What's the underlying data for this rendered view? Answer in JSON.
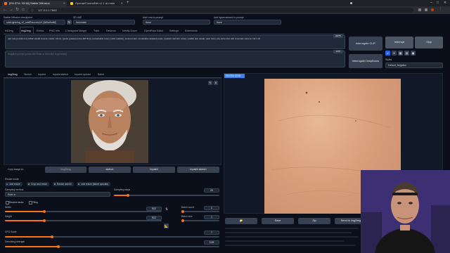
{
  "browser": {
    "tabs": [
      {
        "title": "[0% ETA: 03:36] Stable Diffusion",
        "active": true
      },
      {
        "title": "Openai/ControlNet v1.1 at main",
        "active": false
      }
    ],
    "url": "127.0.0.1:7860",
    "add_tab": "+"
  },
  "top": {
    "checkpoint_label": "Stable Diffusion checkpoint",
    "checkpoint_value": "sdxlLightning_v2_sdxlRecoveryV1 [0d5a0bd6f]",
    "vae_label": "SD VAE",
    "vae_value": "Automatic",
    "lora_label": "Add Lora to prompt",
    "lora_value": "None",
    "hypernetwork_label": "Add hypernetwork to prompt",
    "hypernetwork_value": "None"
  },
  "tabs": [
    "txt2img",
    "img2img",
    "Extras",
    "PNG Info",
    "Checkpoint Merger",
    "Train",
    "Deforum",
    "Infinity Zoom",
    "OpenPose Editor",
    "Settings",
    "Extensions"
  ],
  "selected_tab": "img2img",
  "prompt": {
    "text": "(old man portrait:1.2), RAW candid cinema, studio, 16mm, ((color graded portra 400 film)), (remarkable color), (ultra realistic), textured skin, remarkable detailed pupils, (realistic dull skin noise), (visible skin detail), (skin fuzz), (dry skin) shot with cinematic camera, hdr:1.16",
    "counter": "60/75",
    "negative_placeholder": "Negative prompt (press Ctrl+Enter or Alt+Enter to generate)",
    "negative_counter": "0/75"
  },
  "buttons": {
    "interrogate_clip": "Interrogate CLIP",
    "interrogate_deepbooru": "Interrogate DeepBooru",
    "interrupt": "Interrupt",
    "skip": "Skip",
    "styles_label": "Styles",
    "styles_value": "Default_Negative"
  },
  "subtabs": [
    "img2img",
    "Sketch",
    "Inpaint",
    "Inpaint sketch",
    "Inpaint upload",
    "Batch"
  ],
  "copy_image_to": "Copy image to:",
  "copy_buttons": [
    "img2img",
    "sketch",
    "inpaint",
    "inpaint sketch"
  ],
  "resize": {
    "label": "Resize mode",
    "options": [
      "Just resize",
      "Crop and resize",
      "Resize and fill",
      "Just resize (latent upscale)"
    ],
    "selected": 0
  },
  "sampling": {
    "method_label": "Sampling method",
    "method_value": "Euler a",
    "steps_label": "Sampling steps",
    "steps_value": "20",
    "steps_fraction": 0.13
  },
  "options": {
    "restore_faces": "Restore faces",
    "tiling": "Tiling"
  },
  "size": {
    "width_label": "Width",
    "width_value": "512",
    "width_fraction": 0.25,
    "height_label": "Height",
    "height_value": "512",
    "height_fraction": 0.25,
    "swap_icon": "swap-icon",
    "batch_count_label": "Batch count",
    "batch_count_value": "1",
    "batch_size_label": "Batch size",
    "batch_size_value": "1"
  },
  "cfg": {
    "label": "CFG Scale",
    "value": "7",
    "fraction": 0.22
  },
  "denoise": {
    "label": "Denoising strength",
    "value": "0.25",
    "fraction": 0.25
  },
  "output": {
    "progress_label": "0% ETA: 03:36",
    "actions": [
      "📁",
      "Save",
      "Zip",
      "Send to img2img"
    ]
  },
  "colors": {
    "accent": "#f97316",
    "progress": "#3b82f6",
    "background": "#0b0f19"
  }
}
